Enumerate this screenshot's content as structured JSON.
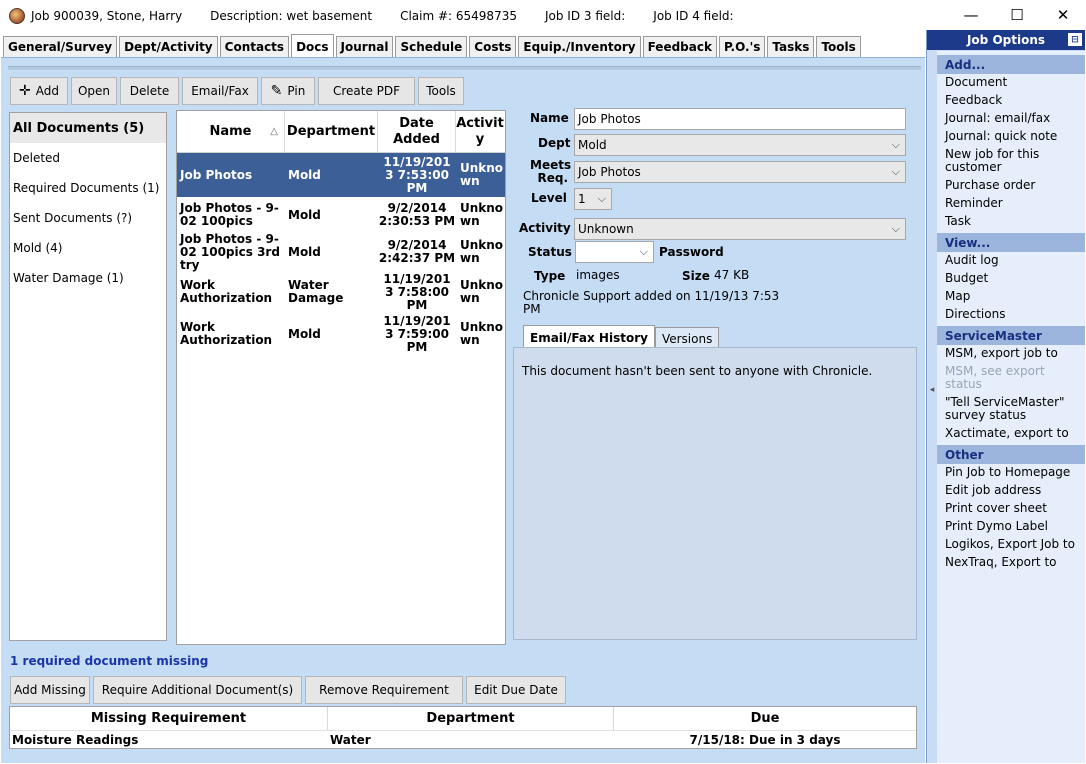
{
  "titlebar": {
    "job": "Job 900039, Stone, Harry",
    "description": "Description: wet basement",
    "claim": "Claim #: 65498735",
    "job3": "Job ID 3 field:",
    "job4": "Job ID 4 field:",
    "minimize": "—",
    "maximize": "☐",
    "close": "✕"
  },
  "tabs": [
    "General/Survey",
    "Dept/Activity",
    "Contacts",
    "Docs",
    "Journal",
    "Schedule",
    "Costs",
    "Equip./Inventory",
    "Feedback",
    "P.O.'s",
    "Tasks",
    "Tools"
  ],
  "toolbar": {
    "add": "Add",
    "open": "Open",
    "delete": "Delete",
    "email_fax": "Email/Fax",
    "pin": "Pin",
    "create_pdf": "Create PDF",
    "tools": "Tools"
  },
  "filters": [
    "All Documents (5)",
    "Deleted",
    "Required Documents (1)",
    "Sent Documents (?)",
    "Mold (4)",
    "Water Damage (1)"
  ],
  "doc_table": {
    "headers": {
      "name": "Name",
      "department": "Department",
      "date_added": "Date Added",
      "activity": "Activit y",
      "sort_arrow": "△"
    },
    "rows": [
      {
        "name": "Job Photos",
        "department": "Mold",
        "date": "11/19/201 3 7:53:00 PM",
        "activity": "Unkno wn"
      },
      {
        "name": "Job Photos - 9-02 100pics",
        "department": "Mold",
        "date": "9/2/2014 2:30:53 PM",
        "activity": "Unkno wn"
      },
      {
        "name": "Job Photos - 9-02 100pics 3rd try",
        "department": "Mold",
        "date": "9/2/2014 2:42:37 PM",
        "activity": "Unkno wn"
      },
      {
        "name": "Work Authorization",
        "department": "Water Damage",
        "date": "11/19/201 3 7:58:00 PM",
        "activity": "Unkno wn"
      },
      {
        "name": "Work Authorization",
        "department": "Mold",
        "date": "11/19/201 3 7:59:00 PM",
        "activity": "Unkno wn"
      }
    ]
  },
  "detail": {
    "name_label": "Name",
    "name_value": "Job Photos",
    "dept_label": "Dept",
    "dept_value": "Mold",
    "meets_label_1": "Meets",
    "meets_label_2": "Req.",
    "meets_value": "Job Photos",
    "level_label": "Level",
    "level_value": "1",
    "activity_label": "Activity",
    "activity_value": "Unknown",
    "status_label": "Status",
    "status_value": "",
    "password_label": "Password",
    "type_label": "Type",
    "type_value": "images",
    "size_label": "Size",
    "size_value": "47 KB",
    "added_note_1": "Chronicle Support added on 11/19/13 7:53",
    "added_note_2": "PM",
    "tab_history": "Email/Fax History",
    "tab_versions": "Versions",
    "history_message": "This document hasn't been sent to anyone with Chronicle."
  },
  "requirements": {
    "missing_note": "1 required document missing",
    "add_missing": "Add Missing",
    "require_additional": "Require Additional Document(s)",
    "remove_requirement": "Remove Requirement",
    "edit_due_date": "Edit Due Date",
    "headers": {
      "requirement": "Missing Requirement",
      "department": "Department",
      "due": "Due"
    },
    "rows": [
      {
        "requirement": "Moisture Readings",
        "department": "Water",
        "due": "7/15/18: Due in 3 days"
      }
    ]
  },
  "job_options": {
    "title": "Job Options",
    "pin_glyph": "⊟",
    "sections": [
      {
        "title": "Add...",
        "items": [
          "Document",
          "Feedback",
          "Journal: email/fax",
          "Journal: quick note",
          "New job for this customer",
          "Purchase order",
          "Reminder",
          "Task"
        ]
      },
      {
        "title": "View...",
        "items": [
          "Audit log",
          "Budget",
          "Map",
          "Directions"
        ]
      },
      {
        "title": "ServiceMaster",
        "items": [
          "MSM, export job to",
          "MSM, see export status",
          "\"Tell ServiceMaster\" survey status",
          "Xactimate, export to"
        ]
      },
      {
        "title": "Other",
        "items": [
          "Pin Job to Homepage",
          "Edit job address",
          "Print cover sheet",
          "Print Dymo Label",
          "Logikos, Export Job to",
          "NexTraq, Export to"
        ]
      }
    ]
  },
  "colors": {
    "selected_row": "#3c5f98",
    "panel_bg": "#c5dcf5",
    "options_header": "#1d3a8a",
    "missing_note": "#1a35a8"
  }
}
